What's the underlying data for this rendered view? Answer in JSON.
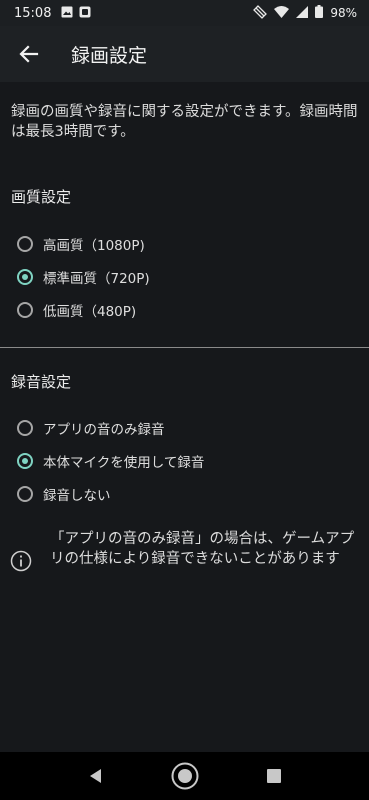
{
  "status": {
    "time": "15:08",
    "battery": "98%",
    "icons": [
      "image-icon",
      "media-icon",
      "rotate-icon",
      "wifi-icon",
      "signal-icon",
      "battery-icon"
    ]
  },
  "header": {
    "title": "録画設定"
  },
  "description": "録画の画質や録音に関する設定ができます。録画時間は最長3時間です。",
  "quality": {
    "title": "画質設定",
    "options": [
      {
        "label": "高画質（1080P)",
        "selected": false
      },
      {
        "label": "標準画質（720P)",
        "selected": true
      },
      {
        "label": "低画質（480P)",
        "selected": false
      }
    ]
  },
  "audio": {
    "title": "録音設定",
    "options": [
      {
        "label": "アプリの音のみ録音",
        "selected": false
      },
      {
        "label": "本体マイクを使用して録音",
        "selected": true
      },
      {
        "label": "録音しない",
        "selected": false
      }
    ]
  },
  "note": "「アプリの音のみ録音」の場合は、ゲームアプリの仕様により録音できないことがあります",
  "colors": {
    "accent": "#7fd3c2",
    "background": "#16181b",
    "appbar": "#1e2124"
  }
}
